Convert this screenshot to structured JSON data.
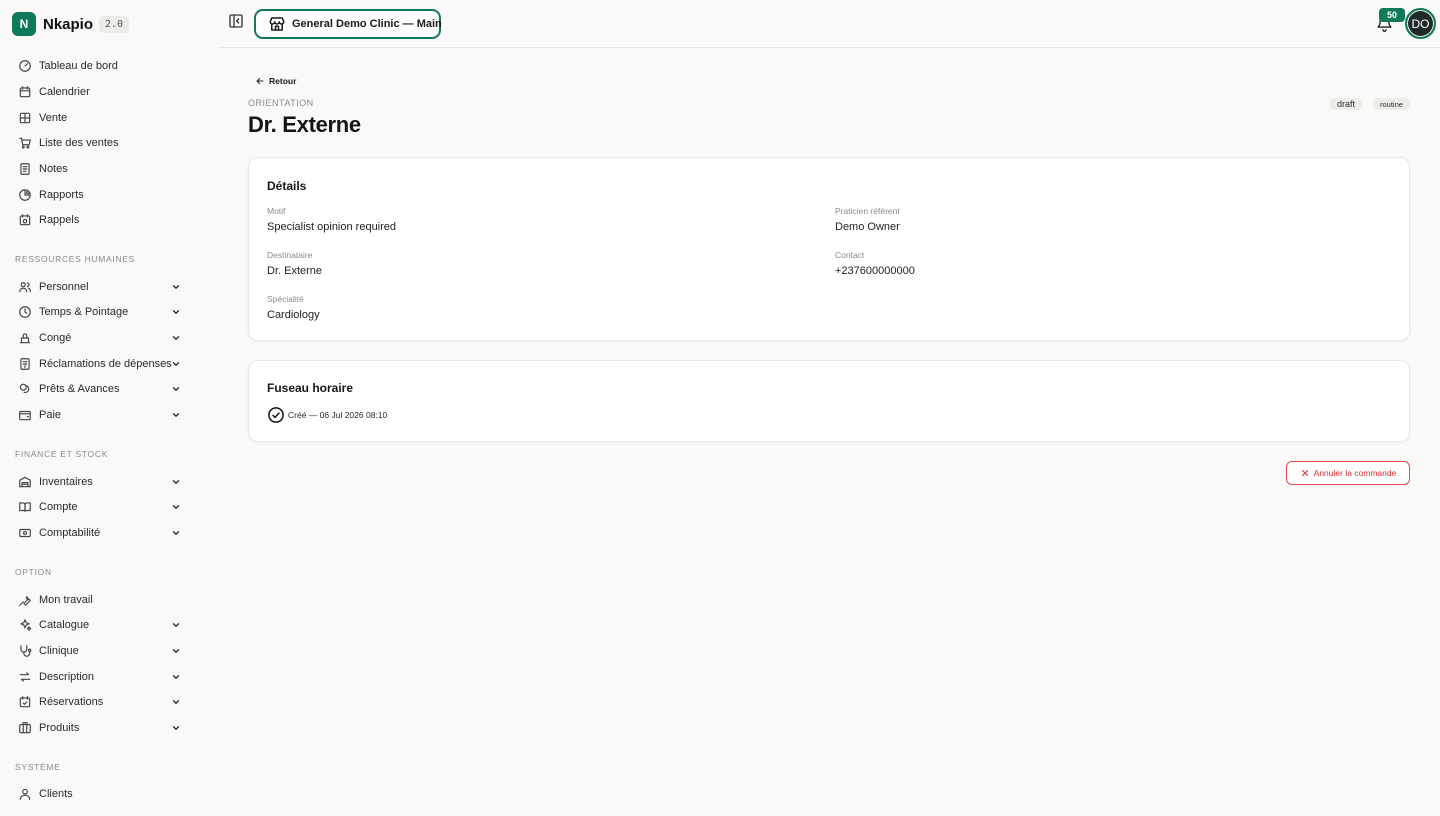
{
  "brand": {
    "logo_letter": "N",
    "name": "Nkapio",
    "version": "2.0"
  },
  "sidebar": {
    "main_items": [
      {
        "label": "Tableau de bord",
        "icon": "dashboard-icon"
      },
      {
        "label": "Calendrier",
        "icon": "calendar-icon"
      },
      {
        "label": "Vente",
        "icon": "pos-grid-icon"
      },
      {
        "label": "Liste des ventes",
        "icon": "cart-icon"
      },
      {
        "label": "Notes",
        "icon": "notes-icon"
      },
      {
        "label": "Rapports",
        "icon": "pie-chart-icon"
      },
      {
        "label": "Rappels",
        "icon": "reminder-calendar-icon"
      }
    ],
    "sections": [
      {
        "label": "RESSOURCES HUMAINES",
        "items": [
          {
            "label": "Personnel",
            "icon": "users-icon"
          },
          {
            "label": "Temps & Pointage",
            "icon": "clock-icon"
          },
          {
            "label": "Congé",
            "icon": "leave-icon"
          },
          {
            "label": "Réclamations de dépenses",
            "icon": "receipt-icon"
          },
          {
            "label": "Prêts & Avances",
            "icon": "coins-icon"
          },
          {
            "label": "Paie",
            "icon": "wallet-icon"
          }
        ]
      },
      {
        "label": "FINANCE ET STOCK",
        "items": [
          {
            "label": "Inventaires",
            "icon": "warehouse-icon"
          },
          {
            "label": "Compte",
            "icon": "book-icon"
          },
          {
            "label": "Comptabilité",
            "icon": "banknote-icon"
          }
        ]
      },
      {
        "label": "OPTION",
        "items": [
          {
            "label": "Mon travail",
            "icon": "wrench-icon"
          },
          {
            "label": "Catalogue",
            "icon": "sparkles-icon"
          },
          {
            "label": "Clinique",
            "icon": "stethoscope-icon"
          },
          {
            "label": "Description",
            "icon": "arrows-exchange-icon"
          },
          {
            "label": "Réservations",
            "icon": "calendar-check-icon"
          },
          {
            "label": "Produits",
            "icon": "package-icon"
          }
        ]
      },
      {
        "label": "SYSTÈME",
        "items": [
          {
            "label": "Clients",
            "icon": "user-icon"
          }
        ]
      }
    ]
  },
  "topbar": {
    "clinic_label": "General Demo Clinic — Main",
    "notification_count": "50",
    "avatar_initials": "DO"
  },
  "page": {
    "back_label": "Retour",
    "kicker": "ORIENTATION",
    "title": "Dr. Externe",
    "badges": [
      "draft",
      "routine"
    ]
  },
  "details": {
    "title": "Détails",
    "fields": [
      {
        "label": "Motif",
        "value": "Specialist opinion required"
      },
      {
        "label": "Praticien référent",
        "value": "Demo Owner"
      },
      {
        "label": "Destinataire",
        "value": "Dr. Externe"
      },
      {
        "label": "Contact",
        "value": "+237600000000"
      },
      {
        "label": "Spécialité",
        "value": "Cardiology"
      }
    ]
  },
  "timeline": {
    "title": "Fuseau horaire",
    "entries": [
      {
        "text": "Créé — 06 Jul 2026 08:10"
      }
    ]
  },
  "actions": {
    "cancel_label": "Annuler la commande"
  },
  "colors": {
    "brand": "#0f7a5a",
    "danger": "#e5484d",
    "background": "#faf9f7"
  }
}
